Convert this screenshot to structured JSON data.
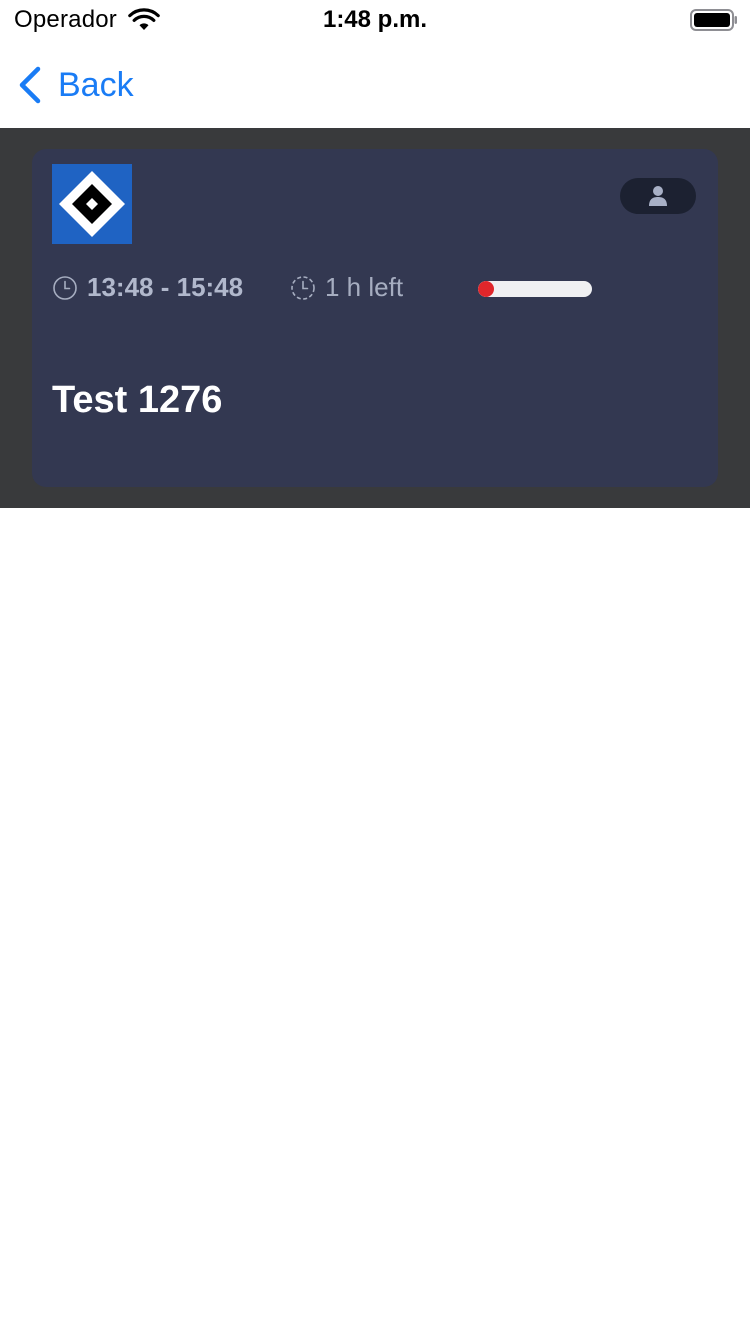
{
  "status_bar": {
    "carrier": "Operador",
    "time": "1:48 p.m.",
    "wifi_icon": "wifi-icon",
    "battery_icon": "battery-icon"
  },
  "nav": {
    "back_label": "Back",
    "back_icon": "chevron-left-icon",
    "accent_color": "#1a7cf5"
  },
  "event": {
    "logo_icon": "team-logo",
    "user_icon": "person-icon",
    "time_range": "13:48 - 15:48",
    "time_left": "1 h left",
    "progress": 0.04,
    "title": "Test 1276",
    "colors": {
      "card": "#333851",
      "section": "#393a3c",
      "progress_fill": "#e0262b",
      "progress_track": "#f0f0f2",
      "logo_bg": "#1f63c3"
    }
  }
}
